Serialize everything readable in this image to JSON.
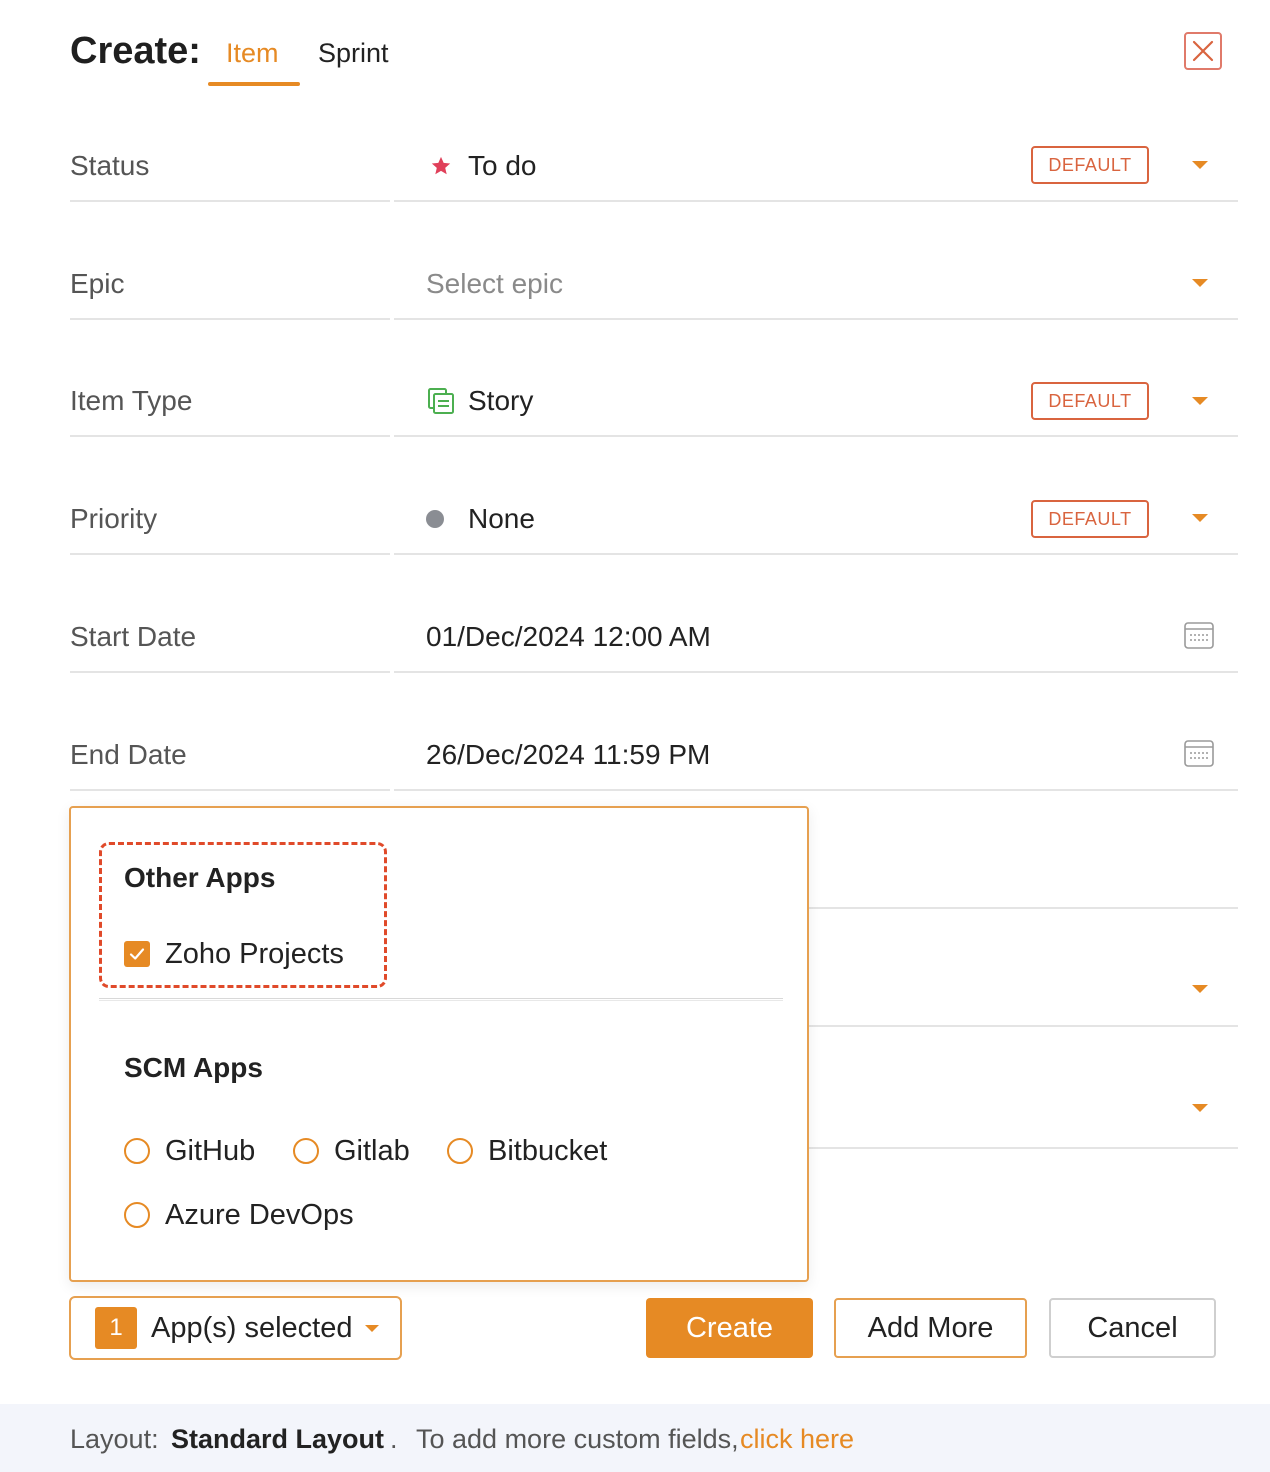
{
  "header": {
    "title": "Create:",
    "tabs": [
      {
        "label": "Item",
        "active": true
      },
      {
        "label": "Sprint",
        "active": false
      }
    ]
  },
  "form": {
    "status": {
      "label": "Status",
      "value": "To do",
      "badge": "DEFAULT"
    },
    "epic": {
      "label": "Epic",
      "placeholder": "Select epic"
    },
    "item_type": {
      "label": "Item Type",
      "value": "Story",
      "badge": "DEFAULT"
    },
    "priority": {
      "label": "Priority",
      "value": "None",
      "badge": "DEFAULT"
    },
    "start_date": {
      "label": "Start Date",
      "value": "01/Dec/2024 12:00 AM"
    },
    "end_date": {
      "label": "End Date",
      "value": "26/Dec/2024 11:59 PM"
    }
  },
  "apps_popup": {
    "other_apps_title": "Other Apps",
    "other_apps": [
      {
        "label": "Zoho Projects",
        "checked": true
      }
    ],
    "scm_apps_title": "SCM Apps",
    "scm_apps": [
      {
        "label": "GitHub"
      },
      {
        "label": "Gitlab"
      },
      {
        "label": "Bitbucket"
      },
      {
        "label": "Azure DevOps"
      }
    ]
  },
  "footer": {
    "apps_selected_count": "1",
    "apps_selected_label": "App(s) selected",
    "create_label": "Create",
    "add_more_label": "Add More",
    "cancel_label": "Cancel"
  },
  "bottom_bar": {
    "layout_prefix": "Layout:",
    "layout_name": "Standard Layout",
    "separator": ".",
    "custom_fields_text": "To add more custom fields,",
    "link_text": "click here"
  },
  "colors": {
    "accent": "#e68a24",
    "badge": "#d9643f",
    "status_star": "#e0405a",
    "story_icon": "#4caf50",
    "priority_dot": "#8a8d93",
    "dashed_highlight": "#e04a2a"
  }
}
